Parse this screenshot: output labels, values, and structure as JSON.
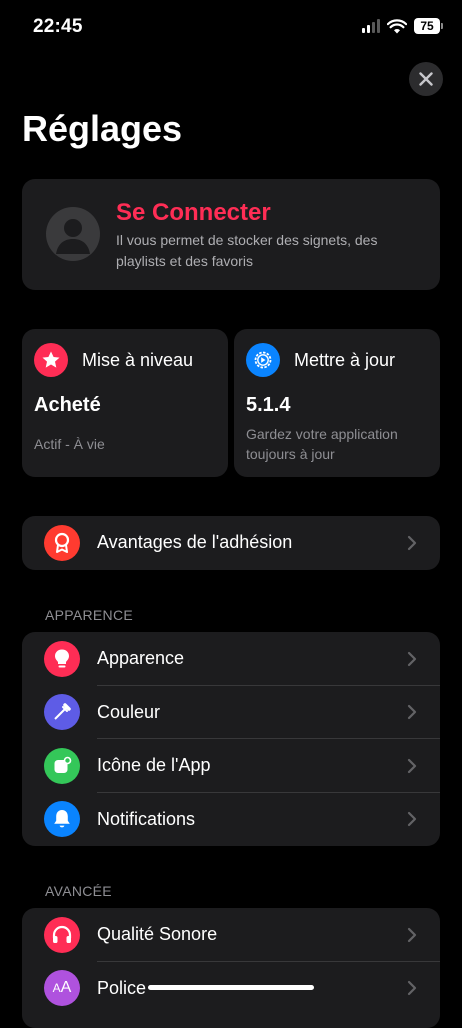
{
  "status_bar": {
    "time": "22:45",
    "battery": "75"
  },
  "page": {
    "title": "Réglages"
  },
  "account": {
    "title": "Se Connecter",
    "description": "Il vous permet de stocker des signets, des playlists et des favoris"
  },
  "upgrade": {
    "label": "Mise à niveau",
    "value": "Acheté",
    "sub": "Actif - À vie"
  },
  "update": {
    "label": "Mettre à jour",
    "value": "5.1.4",
    "sub": "Gardez votre application toujours à jour"
  },
  "membership": {
    "label": "Avantages de l'adhésion"
  },
  "appearance_section": {
    "header": "APPARENCE",
    "items": [
      {
        "label": "Apparence",
        "icon": "lightbulb-icon",
        "color": "#ff2d55"
      },
      {
        "label": "Couleur",
        "icon": "eyedropper-icon",
        "color": "#5e5ce6"
      },
      {
        "label": "Icône de l'App",
        "icon": "app-icon",
        "color": "#34c759"
      },
      {
        "label": "Notifications",
        "icon": "bell-icon",
        "color": "#0a84ff"
      }
    ]
  },
  "advanced_section": {
    "header": "AVANCÉE",
    "items": [
      {
        "label": "Qualité Sonore",
        "icon": "headphones-icon",
        "color": "#ff2d55"
      },
      {
        "label": "Police",
        "icon": "font-icon",
        "color": "#af52de"
      }
    ]
  },
  "colors": {
    "accent": "#ff2d55",
    "background": "#000000",
    "card": "#1c1c1e"
  }
}
